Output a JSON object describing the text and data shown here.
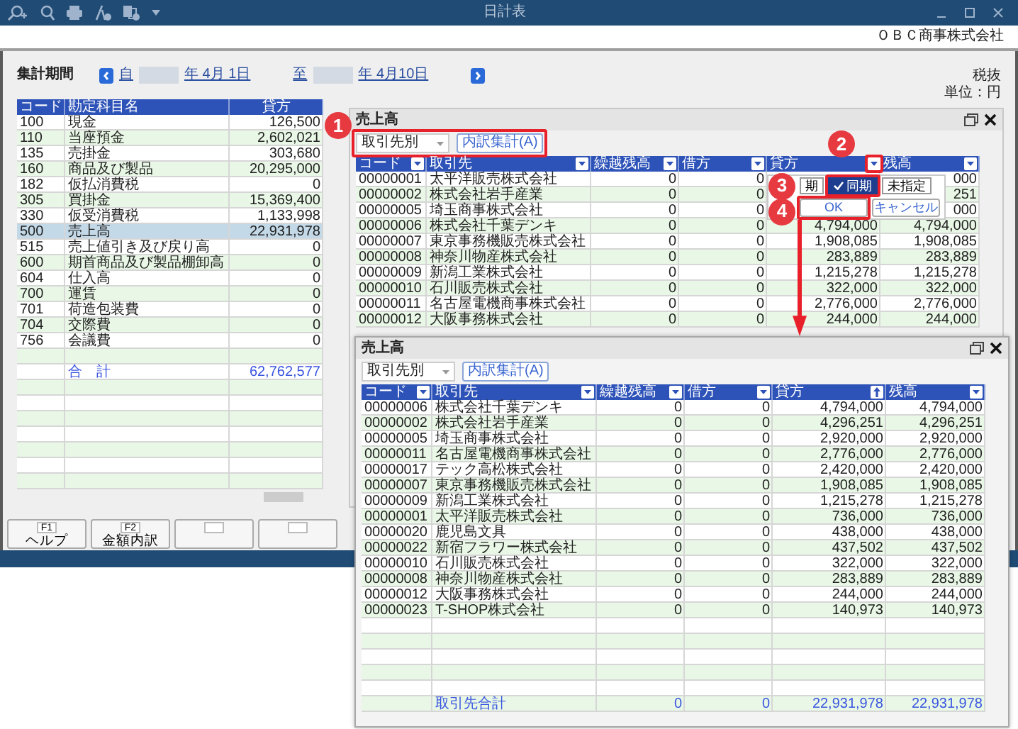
{
  "window": {
    "title": "日計表",
    "company": "ＯＢＣ商事株式会社"
  },
  "period": {
    "label": "集計期間",
    "from_prefix": "自",
    "from_rest": "年  4月 1日",
    "to_prefix": "至",
    "to_rest": "年  4月10日"
  },
  "tax": "税抜",
  "unit": "単位：円",
  "accounts": {
    "columns": [
      "コード",
      "勘定科目名",
      "貸方"
    ],
    "rows": [
      {
        "code": "100",
        "name": "現金",
        "amount": "126,500",
        "selected": false
      },
      {
        "code": "110",
        "name": "当座預金",
        "amount": "2,602,021",
        "selected": false
      },
      {
        "code": "135",
        "name": "売掛金",
        "amount": "303,680",
        "selected": false
      },
      {
        "code": "160",
        "name": "商品及び製品",
        "amount": "20,295,000",
        "selected": false
      },
      {
        "code": "182",
        "name": "仮払消費税",
        "amount": "0",
        "selected": false
      },
      {
        "code": "305",
        "name": "買掛金",
        "amount": "15,369,400",
        "selected": false
      },
      {
        "code": "330",
        "name": "仮受消費税",
        "amount": "1,133,998",
        "selected": false
      },
      {
        "code": "500",
        "name": "売上高",
        "amount": "22,931,978",
        "selected": true
      },
      {
        "code": "515",
        "name": "売上値引き及び戻り高",
        "amount": "0",
        "selected": false
      },
      {
        "code": "600",
        "name": "期首商品及び製品棚卸高",
        "amount": "0",
        "selected": false
      },
      {
        "code": "604",
        "name": "仕入高",
        "amount": "0",
        "selected": false
      },
      {
        "code": "700",
        "name": "運賃",
        "amount": "0",
        "selected": false
      },
      {
        "code": "701",
        "name": "荷造包装費",
        "amount": "0",
        "selected": false
      },
      {
        "code": "704",
        "name": "交際費",
        "amount": "0",
        "selected": false
      },
      {
        "code": "756",
        "name": "会議費",
        "amount": "0",
        "selected": false
      }
    ],
    "total": {
      "label": "合　計",
      "amount": "62,762,577"
    }
  },
  "function_keys": [
    {
      "kind": "key",
      "key": "F1",
      "label": "ヘルプ"
    },
    {
      "kind": "key",
      "key": "F2",
      "label": "金額内訳"
    },
    {
      "kind": "blank"
    },
    {
      "kind": "blank"
    }
  ],
  "panels": [
    {
      "title": "売上高",
      "grouping": "取引先別",
      "breakdown_button": "内訳集計(A)",
      "columns": [
        {
          "label": "コード",
          "sorted": false
        },
        {
          "label": "取引先",
          "sorted": false
        },
        {
          "label": "繰越残高",
          "sorted": false
        },
        {
          "label": "借方",
          "sorted": false
        },
        {
          "label": "貸方",
          "sorted": false
        },
        {
          "label": "残高",
          "sorted": false
        }
      ],
      "rows": [
        [
          "00000001",
          "太平洋販売株式会社",
          "0",
          "0",
          "",
          "000"
        ],
        [
          "00000002",
          "株式会社岩手産業",
          "0",
          "0",
          "",
          "251"
        ],
        [
          "00000005",
          "埼玉商事株式会社",
          "0",
          "0",
          "",
          "000"
        ],
        [
          "00000006",
          "株式会社千葉デンキ",
          "0",
          "0",
          "4,794,000",
          "4,794,000"
        ],
        [
          "00000007",
          "東京事務機販売株式会社",
          "0",
          "0",
          "1,908,085",
          "1,908,085"
        ],
        [
          "00000008",
          "神奈川物産株式会社",
          "0",
          "0",
          "283,889",
          "283,889"
        ],
        [
          "00000009",
          "新潟工業株式会社",
          "0",
          "0",
          "1,215,278",
          "1,215,278"
        ],
        [
          "00000010",
          "石川販売株式会社",
          "0",
          "0",
          "322,000",
          "322,000"
        ],
        [
          "00000011",
          "名古屋電機商事株式会社",
          "0",
          "0",
          "2,776,000",
          "2,776,000"
        ],
        [
          "00000012",
          "大阪事務株式会社",
          "0",
          "0",
          "244,000",
          "244,000"
        ]
      ]
    },
    {
      "title": "売上高",
      "grouping": "取引先別",
      "breakdown_button": "内訳集計(A)",
      "columns": [
        {
          "label": "コード",
          "sorted": false
        },
        {
          "label": "取引先",
          "sorted": false
        },
        {
          "label": "繰越残高",
          "sorted": false
        },
        {
          "label": "借方",
          "sorted": false
        },
        {
          "label": "貸方",
          "sorted": true
        },
        {
          "label": "残高",
          "sorted": false
        }
      ],
      "rows": [
        [
          "00000006",
          "株式会社千葉デンキ",
          "0",
          "0",
          "4,794,000",
          "4,794,000"
        ],
        [
          "00000002",
          "株式会社岩手産業",
          "0",
          "0",
          "4,296,251",
          "4,296,251"
        ],
        [
          "00000005",
          "埼玉商事株式会社",
          "0",
          "0",
          "2,920,000",
          "2,920,000"
        ],
        [
          "00000011",
          "名古屋電機商事株式会社",
          "0",
          "0",
          "2,776,000",
          "2,776,000"
        ],
        [
          "00000017",
          "テック高松株式会社",
          "0",
          "0",
          "2,420,000",
          "2,420,000"
        ],
        [
          "00000007",
          "東京事務機販売株式会社",
          "0",
          "0",
          "1,908,085",
          "1,908,085"
        ],
        [
          "00000009",
          "新潟工業株式会社",
          "0",
          "0",
          "1,215,278",
          "1,215,278"
        ],
        [
          "00000001",
          "太平洋販売株式会社",
          "0",
          "0",
          "736,000",
          "736,000"
        ],
        [
          "00000020",
          "鹿児島文具",
          "0",
          "0",
          "438,000",
          "438,000"
        ],
        [
          "00000022",
          "新宿フラワー株式会社",
          "0",
          "0",
          "437,502",
          "437,502"
        ],
        [
          "00000010",
          "石川販売株式会社",
          "0",
          "0",
          "322,000",
          "322,000"
        ],
        [
          "00000008",
          "神奈川物産株式会社",
          "0",
          "0",
          "283,889",
          "283,889"
        ],
        [
          "00000012",
          "大阪事務株式会社",
          "0",
          "0",
          "244,000",
          "244,000"
        ],
        [
          "00000023",
          "T-SHOP株式会社",
          "0",
          "0",
          "140,973",
          "140,973"
        ]
      ],
      "total": {
        "label": "取引先合計",
        "values": [
          "0",
          "0",
          "22,931,978",
          "22,931,978"
        ]
      }
    }
  ],
  "filter_popup": {
    "options": [
      {
        "label": "期",
        "selected": false
      },
      {
        "label": "同期",
        "selected": true
      },
      {
        "label": "未指定",
        "selected": false
      }
    ],
    "buttons": [
      "OK",
      "キャンセル"
    ]
  },
  "annotations": [
    {
      "number": "1"
    },
    {
      "number": "2"
    },
    {
      "number": "3"
    },
    {
      "number": "4"
    }
  ]
}
